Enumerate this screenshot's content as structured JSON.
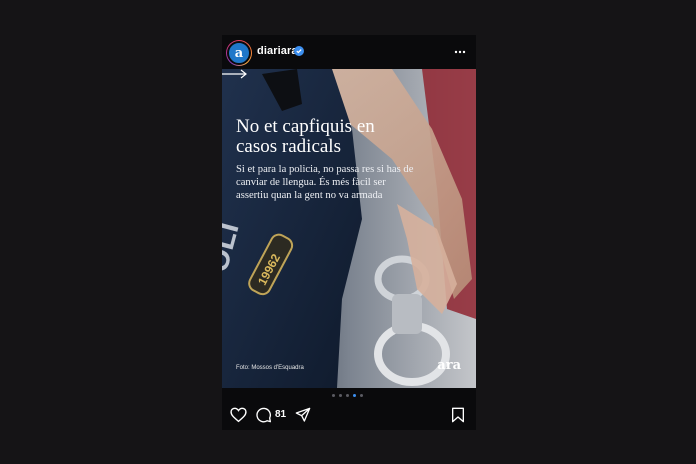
{
  "post": {
    "account": {
      "avatar_letter": "a",
      "username": "diariara",
      "verified": true,
      "more_icon": "more-horizontal-icon"
    },
    "media": {
      "headline_line1": "No et capfiquis en",
      "headline_line2": "casos radicals",
      "subhead_line1": "Si et para la policia, no passa res si has de",
      "subhead_line2": "canviar de llengua. És més fàcil ser",
      "subhead_line3": "assertiu quan la gent no va armada",
      "credit": "Foto: Mossos d'Esquadra",
      "brand": "ara",
      "arrow_icon": "arrow-right-icon"
    },
    "carousel": {
      "total": 5,
      "active_index": 3
    },
    "actions": {
      "like_icon": "heart-icon",
      "comment_icon": "comment-icon",
      "comment_count": "81",
      "share_icon": "send-icon",
      "save_icon": "bookmark-icon"
    }
  },
  "colors": {
    "background": "#151416",
    "card": "#0a0a0c",
    "verified": "#3c8ff0",
    "active_dot": "#3c8ff0"
  }
}
